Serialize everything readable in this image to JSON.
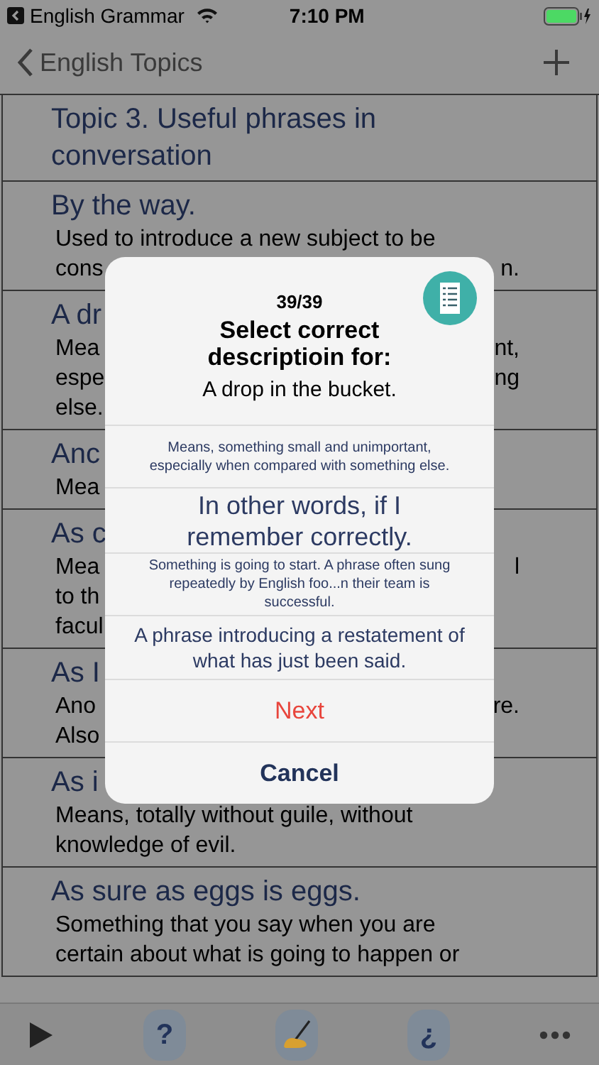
{
  "status_bar": {
    "back_app": "English Grammar",
    "time": "7:10 PM"
  },
  "nav": {
    "back": "English Topics"
  },
  "list": [
    {
      "title": "Topic 3. Useful phrases in conversation"
    },
    {
      "title": "By the way.",
      "lines": [
        {
          "text": "Used to introduce a new subject to be"
        },
        {
          "left": "cons",
          "right": "n."
        }
      ]
    },
    {
      "title": "A dr",
      "lines": [
        {
          "left": "Mea",
          "right": "nt,"
        },
        {
          "left": "espe",
          "right": "ng"
        },
        {
          "left": "else."
        }
      ]
    },
    {
      "title": "Anc",
      "lines": [
        {
          "left": "Mea"
        }
      ]
    },
    {
      "title": "As c",
      "lines": [
        {
          "left": "Mea",
          "right": "l"
        },
        {
          "left": "to th"
        },
        {
          "left": "facul"
        }
      ]
    },
    {
      "title": "As I",
      "lines": [
        {
          "left": "Ano",
          "right": "re."
        },
        {
          "left": "Also"
        }
      ]
    },
    {
      "title": "As i",
      "lines": [
        {
          "text": "Means, totally without guile, without"
        },
        {
          "text": "knowledge of evil."
        }
      ]
    },
    {
      "title": "As sure as eggs is eggs.",
      "lines": [
        {
          "text": "Something that you say when you are"
        },
        {
          "text": "certain about what is going to happen or"
        }
      ]
    }
  ],
  "dialog": {
    "counter": "39/39",
    "title": "Select correct descriptioin for:",
    "phrase": "A drop in the bucket.",
    "options": [
      {
        "kind": "small",
        "text": "Means, something small and unimportant, especially when compared with something else."
      },
      {
        "kind": "large",
        "text": "In other words, if I remember correctly."
      },
      {
        "kind": "small",
        "text": "Something is going to start. A phrase often sung repeatedly by English foo...n their team is successful."
      },
      {
        "kind": "medium",
        "text": "A phrase introducing a restatement of what has just been said."
      }
    ],
    "next": "Next",
    "cancel": "Cancel"
  },
  "toolbar": {
    "help": "?",
    "inverted_help": "¿"
  }
}
